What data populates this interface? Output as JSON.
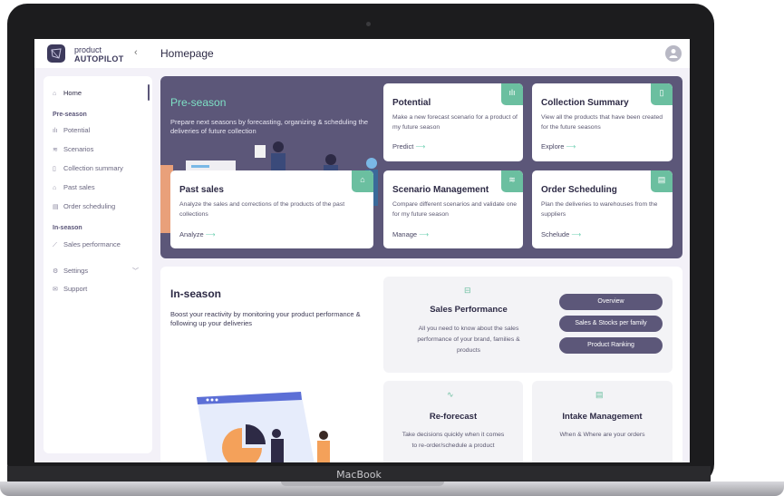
{
  "device": {
    "brand": "MacBook"
  },
  "header": {
    "logo_line1": "product",
    "logo_line2": "AUTOPILOT",
    "collapse_glyph": "‹",
    "title": "Homepage"
  },
  "sidebar": {
    "home": "Home",
    "pre_season_heading": "Pre-season",
    "pre_season_items": [
      "Potential",
      "Scenarios",
      "Collection summary",
      "Past sales",
      "Order scheduling"
    ],
    "in_season_heading": "In-season",
    "in_season_items": [
      "Sales performance"
    ],
    "settings": "Settings",
    "support": "Support"
  },
  "pre_season": {
    "title": "Pre-season",
    "description": "Prepare next seasons by forecasting, organizing & scheduling the deliveries of future collection",
    "cards": [
      {
        "title": "Potential",
        "description": "Make a new forecast scenario for a product of my future season",
        "link": "Predict",
        "icon": "bar-chart-icon"
      },
      {
        "title": "Collection Summary",
        "description": "View all the products that have been created for the future seasons",
        "link": "Explore",
        "icon": "document-icon"
      },
      {
        "title": "Past sales",
        "description": "Analyze the sales and corrections of the products of the past collections",
        "link": "Analyze",
        "icon": "basket-icon"
      },
      {
        "title": "Scenario Management",
        "description": "Compare different scenarios and validate one for my future season",
        "link": "Manage",
        "icon": "layers-icon"
      },
      {
        "title": "Order Scheduling",
        "description": "Plan the deliveries to warehouses from the suppliers",
        "link": "Schelude",
        "icon": "calendar-icon"
      }
    ],
    "arrow": "⟶"
  },
  "in_season": {
    "title": "In-season",
    "description": "Boost your reactivity by monitoring your product performance & following up your deliveries",
    "sales_performance": {
      "title": "Sales Performance",
      "description": "All you need to know about the sales performance of your brand, families & products",
      "buttons": [
        "Overview",
        "Sales & Stocks per family",
        "Product Ranking"
      ]
    },
    "reforecast": {
      "title": "Re-forecast",
      "description": "Take decisions quickly when it comes to re-order/schedule a product"
    },
    "intake": {
      "title": "Intake Management",
      "description": "When & Where are your orders"
    }
  },
  "colors": {
    "primary": "#5c5779",
    "accent": "#6bbfa0",
    "accent_text": "#7ee0c5",
    "background": "#f3f1f8"
  }
}
